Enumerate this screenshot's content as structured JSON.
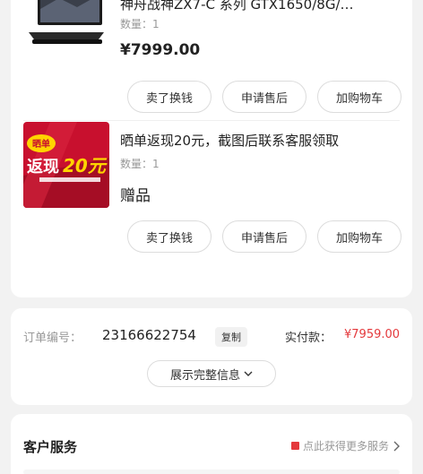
{
  "products": [
    {
      "title": "神舟战神ZX7-C 系列 GTX1650/8G/…",
      "qty_label": "数量：1",
      "price": "¥7999.00",
      "thumb_icon": "laptop-image",
      "buttons": [
        "卖了换钱",
        "申请售后",
        "加购物车"
      ]
    },
    {
      "title": "晒单返现20元，截图后联系客服领取",
      "qty_label": "数量：1",
      "gift_label": "赠品",
      "thumb_icon": "cashback-promo-image",
      "thumb_text": {
        "top": "晒单",
        "main": "返现",
        "num": "20元"
      },
      "buttons": [
        "卖了换钱",
        "申请售后",
        "加购物车"
      ]
    }
  ],
  "order": {
    "number_label": "订单编号：",
    "number": "23166622754",
    "copy_label": "复制",
    "paid_label": "实付款：",
    "paid_amount": "¥7959.00",
    "expand_label": "展示完整信息"
  },
  "service": {
    "title": "客户服务",
    "link_label": "点此获得更多服务"
  },
  "colors": {
    "accent": "#e4393c",
    "page_bg": "#f2f2f2",
    "card_bg": "#ffffff"
  }
}
